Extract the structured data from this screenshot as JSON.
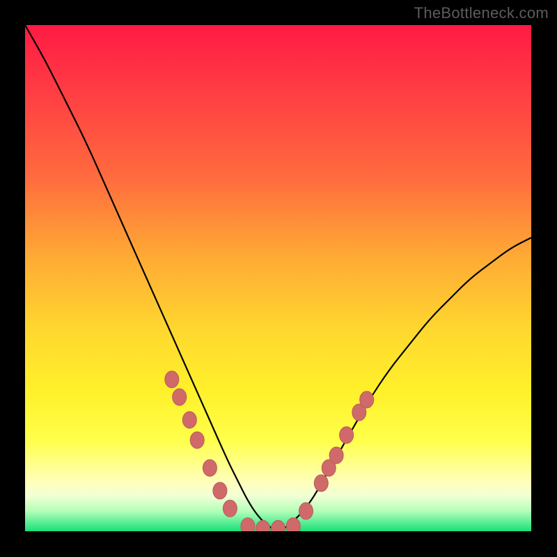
{
  "attribution": "TheBottleneck.com",
  "colors": {
    "curve": "#000000",
    "marker_fill": "#d06a6a",
    "marker_stroke": "#b85a5a"
  },
  "chart_data": {
    "type": "line",
    "title": "",
    "xlabel": "",
    "ylabel": "",
    "xlim": [
      0,
      100
    ],
    "ylim": [
      0,
      100
    ],
    "series": [
      {
        "name": "bottleneck-curve",
        "x": [
          0,
          4,
          8,
          12,
          16,
          20,
          24,
          28,
          32,
          36,
          40,
          42,
          44,
          46,
          48,
          50,
          52,
          56,
          60,
          64,
          68,
          72,
          76,
          80,
          84,
          88,
          92,
          96,
          100
        ],
        "y": [
          100,
          93,
          85,
          77,
          68,
          59,
          50,
          41,
          32,
          23,
          14,
          10,
          6,
          3,
          1,
          0,
          1,
          5,
          12,
          19,
          26,
          32,
          37,
          42,
          46,
          50,
          53,
          56,
          58
        ]
      }
    ],
    "markers": [
      {
        "x": 29.0,
        "y": 30.0
      },
      {
        "x": 30.5,
        "y": 26.5
      },
      {
        "x": 32.5,
        "y": 22.0
      },
      {
        "x": 34.0,
        "y": 18.0
      },
      {
        "x": 36.5,
        "y": 12.5
      },
      {
        "x": 38.5,
        "y": 8.0
      },
      {
        "x": 40.5,
        "y": 4.5
      },
      {
        "x": 44.0,
        "y": 1.0
      },
      {
        "x": 47.0,
        "y": 0.5
      },
      {
        "x": 50.0,
        "y": 0.5
      },
      {
        "x": 53.0,
        "y": 1.0
      },
      {
        "x": 55.5,
        "y": 4.0
      },
      {
        "x": 58.5,
        "y": 9.5
      },
      {
        "x": 60.0,
        "y": 12.5
      },
      {
        "x": 61.5,
        "y": 15.0
      },
      {
        "x": 63.5,
        "y": 19.0
      },
      {
        "x": 66.0,
        "y": 23.5
      },
      {
        "x": 67.5,
        "y": 26.0
      }
    ]
  }
}
